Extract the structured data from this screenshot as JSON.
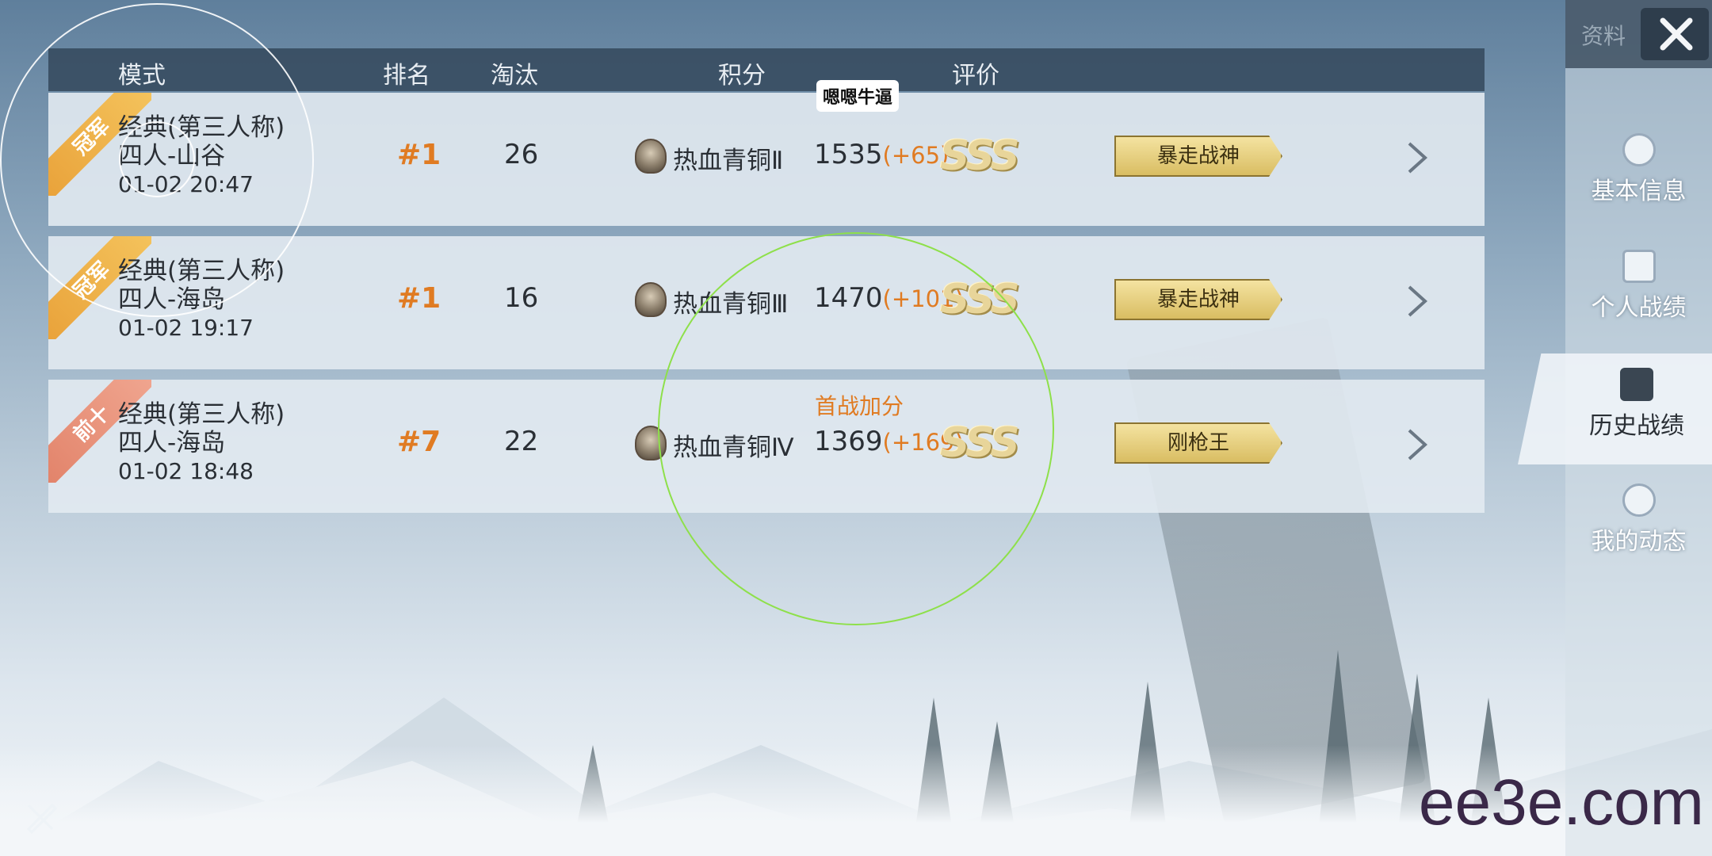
{
  "header": {
    "mode": "模式",
    "rank": "排名",
    "kills": "淘汰",
    "score": "积分",
    "rating": "评价"
  },
  "tooltip": "嗯嗯牛逼",
  "rows": [
    {
      "badge": "冠军",
      "mode": "经典(第三人称)",
      "map": "四人-山谷",
      "time": "01-02 20:47",
      "rank": "#1",
      "kills": "26",
      "tier": "热血青铜Ⅱ",
      "score": "1535",
      "delta": "(+65)",
      "grade": "SSS",
      "title": "暴走战神"
    },
    {
      "badge": "冠军",
      "mode": "经典(第三人称)",
      "map": "四人-海岛",
      "time": "01-02 19:17",
      "rank": "#1",
      "kills": "16",
      "tier": "热血青铜Ⅲ",
      "score": "1470",
      "delta": "(+101)",
      "grade": "SSS",
      "title": "暴走战神"
    },
    {
      "badge": "前十",
      "mode": "经典(第三人称)",
      "map": "四人-海岛",
      "time": "01-02 18:48",
      "rank": "#7",
      "kills": "22",
      "tier": "热血青铜Ⅳ",
      "score": "1369",
      "delta": "(+169)",
      "bonus": "首战加分",
      "grade": "SSS",
      "title": "刚枪王"
    }
  ],
  "sidebar": {
    "top_label": "资料",
    "items": [
      {
        "label": "基本信息",
        "icon": "profile-icon"
      },
      {
        "label": "个人战绩",
        "icon": "stats-icon"
      },
      {
        "label": "历史战绩",
        "icon": "history-icon"
      },
      {
        "label": "我的动态",
        "icon": "activity-icon"
      }
    ]
  },
  "watermark": "ee3e.com",
  "colors": {
    "header_bg": "#34485c",
    "accent_orange": "#e07b22",
    "gold_badge": "#f4c35c",
    "red_badge": "#f0a58f"
  }
}
